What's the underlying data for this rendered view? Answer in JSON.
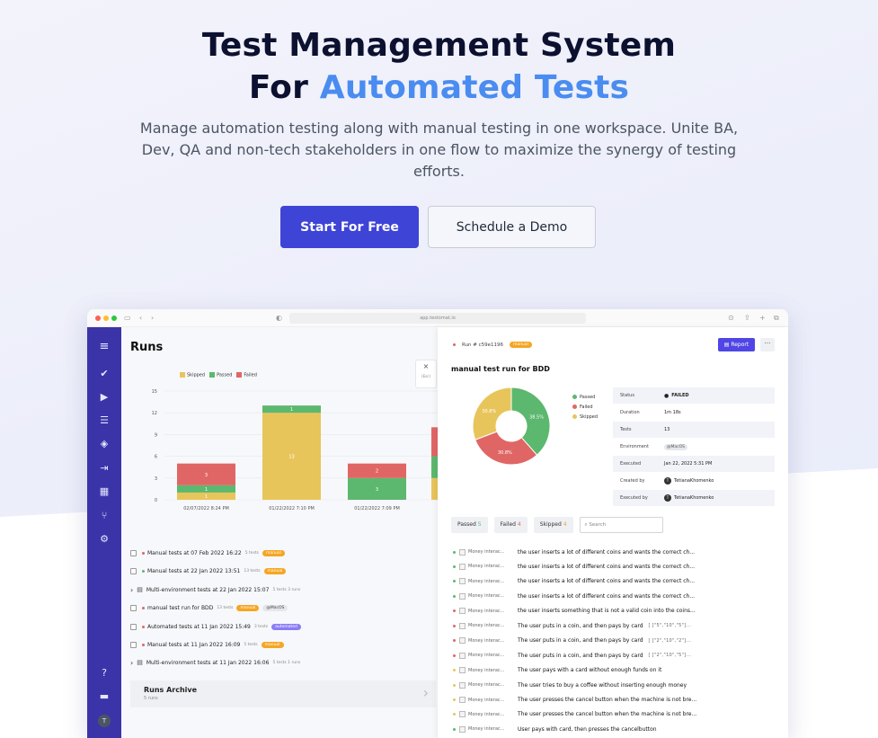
{
  "hero": {
    "title_line1": "Test Management System",
    "title_line2_prefix": "For ",
    "title_line2_accent": "Automated Tests",
    "subtitle": "Manage automation testing along with manual testing in one workspace. Unite BA, Dev, QA and non-tech stakeholders in one flow to maximize the synergy of testing efforts.",
    "primary_cta": "Start For Free",
    "secondary_cta": "Schedule a Demo"
  },
  "browser": {
    "url": "app.testomat.io"
  },
  "runs": {
    "title": "Runs",
    "legend": [
      "Skipped",
      "Passed",
      "Failed"
    ],
    "colors": {
      "skipped": "#e8c55b",
      "passed": "#5cb86e",
      "failed": "#e06666"
    },
    "items": [
      {
        "status": "failed",
        "name": "Manual tests at 07 Feb 2022 16:22",
        "meta": "5 tests",
        "tag": "manual",
        "tag_type": "manual"
      },
      {
        "status": "passed",
        "name": "Manual tests at 22 Jan 2022 13:51",
        "meta": "13 tests",
        "tag": "manual",
        "tag_type": "manual"
      },
      {
        "status": "group",
        "name": "Multi-environment tests at 22 Jan 2022 15:07",
        "meta": "5 tests   3 runs",
        "tag": "",
        "tag_type": ""
      },
      {
        "status": "failed",
        "name": "manual test run for BDD",
        "meta": "13 tests",
        "tag": "manual",
        "tag_type": "manual",
        "env": "@MacOS"
      },
      {
        "status": "failed",
        "name": "Automated tests at 11 Jan 2022 15:49",
        "meta": "3 tests",
        "tag": "automated",
        "tag_type": "auto"
      },
      {
        "status": "failed",
        "name": "Manual tests at 11 Jan 2022 16:09",
        "meta": "5 tests",
        "tag": "manual",
        "tag_type": "manual"
      },
      {
        "status": "group",
        "name": "Multi-environment tests at 11 Jan 2022 16:06",
        "meta": "5 tests   1 runs",
        "tag": "",
        "tag_type": ""
      }
    ],
    "archive_title": "Runs Archive",
    "archive_sub": "5 runs"
  },
  "chart_data": {
    "type": "bar",
    "stacked": true,
    "categories": [
      "02/07/2022 8:24 PM",
      "01/22/2022 7:10 PM",
      "01/22/2022 7:09 PM",
      ""
    ],
    "series": [
      {
        "name": "Skipped",
        "values": [
          1,
          12,
          0,
          3
        ]
      },
      {
        "name": "Passed",
        "values": [
          1,
          1,
          3,
          3
        ]
      },
      {
        "name": "Failed",
        "values": [
          3,
          0,
          2,
          4
        ]
      }
    ],
    "data_labels": {
      "Skipped": [
        "1",
        "13",
        "",
        ""
      ],
      "Passed": [
        "1",
        "1",
        "3",
        ""
      ],
      "Failed": [
        "3",
        "",
        "2",
        ""
      ]
    },
    "y_ticks": [
      0,
      3,
      6,
      9,
      12,
      15
    ],
    "ylim": [
      0,
      15
    ],
    "grid": true,
    "legend_position": "top-left"
  },
  "detail": {
    "run_label": "Run # c59e1196",
    "run_tag": "manual",
    "report_label": "Report",
    "more_label": "···",
    "title": "manual test run for BDD",
    "close_label": "×",
    "close_hint": "(Esc)",
    "pie": {
      "legend": [
        "Passed",
        "Failed",
        "Skipped"
      ],
      "values": [
        38.5,
        30.8,
        30.8
      ],
      "labels": [
        "38.5%",
        "30.8%",
        "30.8%"
      ],
      "colors": [
        "#5cb86e",
        "#e06666",
        "#e8c55b"
      ]
    },
    "info": [
      {
        "key": "Status",
        "value": "FAILED"
      },
      {
        "key": "Duration",
        "value": "1m 18s"
      },
      {
        "key": "Tests",
        "value": "13"
      },
      {
        "key": "Environment",
        "value": "@MacOS"
      },
      {
        "key": "Executed",
        "value": "Jan 22, 2022 5:31 PM"
      },
      {
        "key": "Created by",
        "value": "TetianaKhomenko"
      },
      {
        "key": "Executed by",
        "value": "TetianaKhomenko"
      }
    ],
    "filters": [
      {
        "label": "Passed",
        "count": "5"
      },
      {
        "label": "Failed",
        "count": "4"
      },
      {
        "label": "Skipped",
        "count": "4"
      }
    ],
    "search_placeholder": "Search",
    "tests": [
      {
        "status": "passed",
        "suite": "Money interac...",
        "name": "the user inserts a lot of different coins and wants the correct ch...",
        "ex": ""
      },
      {
        "status": "passed",
        "suite": "Money interac...",
        "name": "the user inserts a lot of different coins and wants the correct ch...",
        "ex": ""
      },
      {
        "status": "passed",
        "suite": "Money interac...",
        "name": "the user inserts a lot of different coins and wants the correct ch...",
        "ex": ""
      },
      {
        "status": "passed",
        "suite": "Money interac...",
        "name": "the user inserts a lot of different coins and wants the correct ch...",
        "ex": ""
      },
      {
        "status": "failed",
        "suite": "Money interac...",
        "name": "the user inserts something that is not a valid coin into the coins...",
        "ex": ""
      },
      {
        "status": "failed",
        "suite": "Money interac...",
        "name": "The user puts in a coin, and then pays by card",
        "ex": "[ [\"5\",\"10\",\"5\"]..."
      },
      {
        "status": "failed",
        "suite": "Money interac...",
        "name": "The user puts in a coin, and then pays by card",
        "ex": "[ [\"2\",\"10\",\"2\"]..."
      },
      {
        "status": "failed",
        "suite": "Money interac...",
        "name": "The user puts in a coin, and then pays by card",
        "ex": "[ [\"2\",\"10\",\"5\"]..."
      },
      {
        "status": "skipped",
        "suite": "Money interac...",
        "name": "The user pays with a card without enough funds on it",
        "ex": ""
      },
      {
        "status": "skipped",
        "suite": "Money interac...",
        "name": "The user tries to buy a coffee without inserting enough money",
        "ex": ""
      },
      {
        "status": "skipped",
        "suite": "Money interac...",
        "name": "The user presses the cancel button when the machine is not bre...",
        "ex": ""
      },
      {
        "status": "skipped",
        "suite": "Money interac...",
        "name": "The user presses the cancel button when the machine is not bre...",
        "ex": ""
      },
      {
        "status": "passed",
        "suite": "Money interac...",
        "name": "User pays with card, then presses the cancelbutton",
        "ex": ""
      }
    ]
  },
  "user_avatar": "T",
  "created_avatar": "T"
}
